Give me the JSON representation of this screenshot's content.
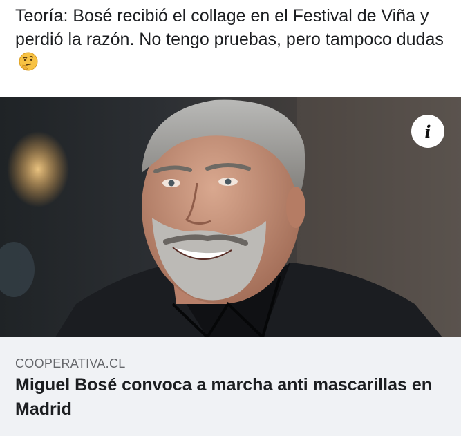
{
  "post": {
    "text": "Teoría: Bosé recibió el collage en el Festival de Viña y perdió la razón. No tengo pruebas, pero tampoco dudas",
    "emoji": "thinking-face-icon"
  },
  "link_preview": {
    "image_alt": "Photo of a smiling man with grey hair and beard in a dark jacket",
    "info_glyph": "i",
    "source": "COOPERATIVA.CL",
    "headline": "Miguel Bosé convoca a marcha anti mascarillas en Madrid"
  }
}
